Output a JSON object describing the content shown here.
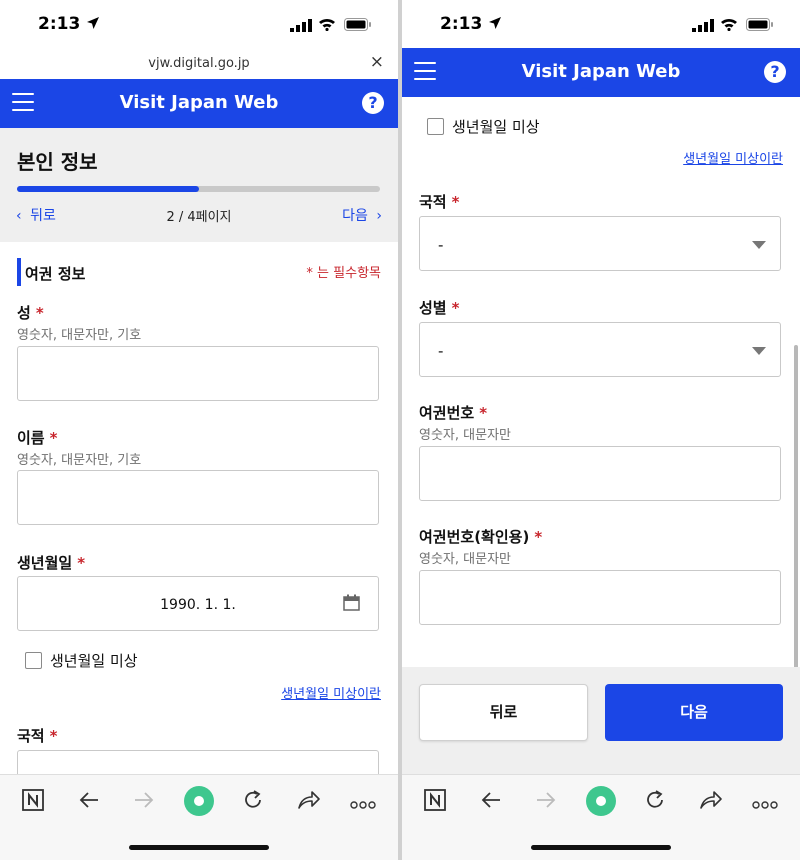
{
  "status": {
    "time": "2:13"
  },
  "browser": {
    "url": "vjw.digital.go.jp",
    "close": "×"
  },
  "app": {
    "title": "Visit Japan Web",
    "help": "?"
  },
  "colors": {
    "brand": "#1b46e6",
    "required": "#c8262d"
  },
  "header": {
    "title": "본인 정보",
    "progress": 0.5,
    "back": "뒤로",
    "page": "2 / 4페이지",
    "next": "다음"
  },
  "section": {
    "title": "여권 정보",
    "required_note": "* 는 필수항목"
  },
  "fields": {
    "surname": {
      "label": "성",
      "hint": "영숫자, 대문자만, 기호",
      "value": ""
    },
    "given_name": {
      "label": "이름",
      "hint": "영숫자, 대문자만, 기호",
      "value": ""
    },
    "birthdate": {
      "label": "생년월일",
      "value": "1990. 1. 1."
    },
    "birth_unknown": {
      "label": "생년월일 미상",
      "link": "생년월일 미상이란",
      "checked": false
    },
    "nationality": {
      "label": "국적",
      "value": "-"
    },
    "gender": {
      "label": "성별",
      "value": "-"
    },
    "passport_no": {
      "label": "여권번호",
      "hint": "영숫자, 대문자만",
      "value": ""
    },
    "passport_confirm": {
      "label": "여권번호(확인용)",
      "hint": "영숫자, 대문자만",
      "value": ""
    }
  },
  "required_mark": "*",
  "footer": {
    "back": "뒤로",
    "next": "다음"
  },
  "toolbar_icons": [
    "n-logo-icon",
    "back-arrow-icon",
    "forward-arrow-icon",
    "home-circle-icon",
    "reload-icon",
    "share-icon",
    "more-icon"
  ]
}
